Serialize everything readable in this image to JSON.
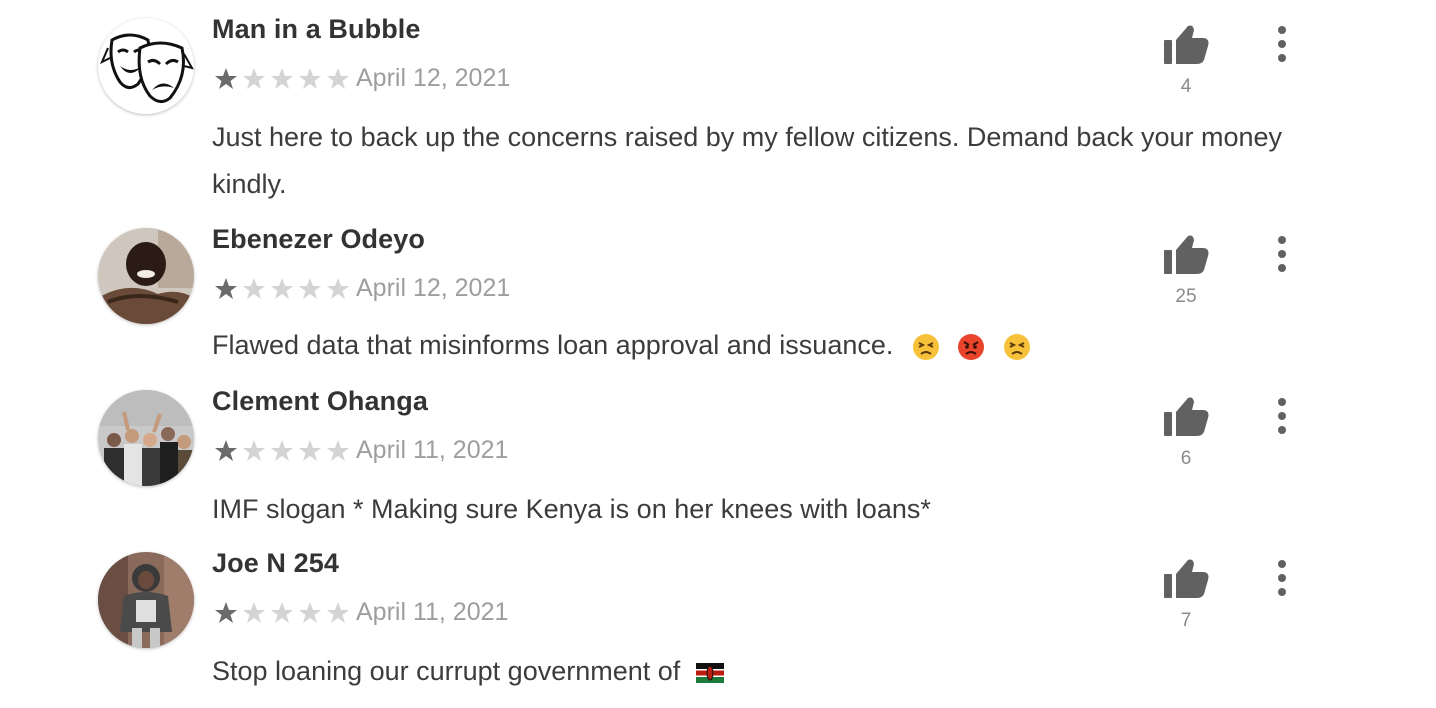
{
  "reviews": [
    {
      "name": "Man in a Bubble",
      "rating": 1,
      "max_rating": 5,
      "date": "April 12, 2021",
      "text": "Just here to back up the concerns raised by my fellow citizens. Demand back your money kindly.",
      "emojis": [],
      "likes": "4",
      "avatar": "theatre-masks-avatar"
    },
    {
      "name": "Ebenezer Odeyo",
      "rating": 1,
      "max_rating": 5,
      "date": "April 12, 2021",
      "text": "Flawed data that misinforms loan approval and issuance.",
      "emojis": [
        "persevering-face",
        "pouting-face",
        "persevering-face"
      ],
      "likes": "25",
      "avatar": "photo-avatar"
    },
    {
      "name": "Clement Ohanga",
      "rating": 1,
      "max_rating": 5,
      "date": "April 11, 2021",
      "text": "IMF slogan * Making sure Kenya is on her knees with loans*",
      "emojis": [],
      "likes": "6",
      "avatar": "crowd-photo-avatar"
    },
    {
      "name": "Joe N 254",
      "rating": 1,
      "max_rating": 5,
      "date": "April 11, 2021",
      "text": "Stop loaning our currupt government of",
      "emojis": [
        "kenya-flag"
      ],
      "likes": "7",
      "avatar": "person-photo-avatar"
    }
  ],
  "colors": {
    "star_filled": "#6b6b6b",
    "star_empty": "#d4d4d4",
    "icon": "#616161",
    "date": "#9e9e9e",
    "likes": "#8a8a8a"
  },
  "icons": {
    "thumb": "thumbs-up-icon",
    "more": "more-vertical-icon",
    "star": "star-icon"
  }
}
